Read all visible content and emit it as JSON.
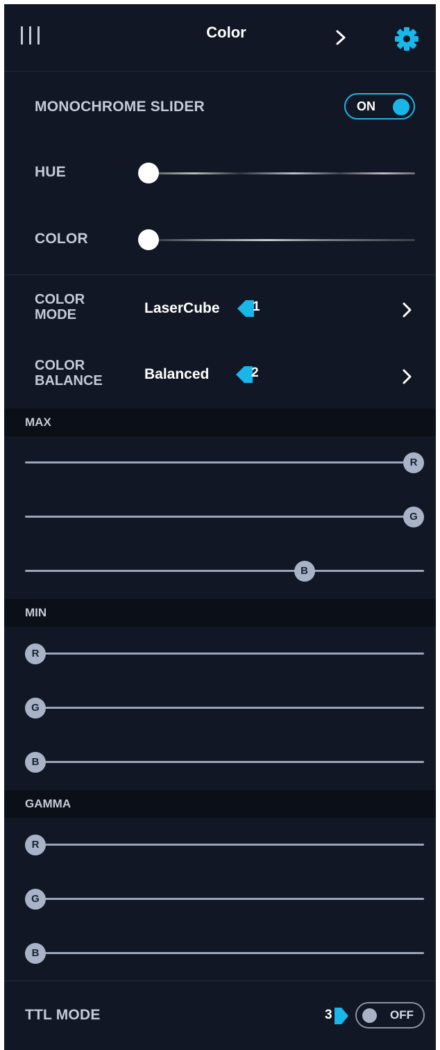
{
  "header": {
    "title": "Color"
  },
  "monochrome": {
    "label": "MONOCHROME SLIDER",
    "toggle_text": "ON",
    "toggle_on": true
  },
  "hue": {
    "label": "HUE",
    "value": 0
  },
  "color": {
    "label": "COLOR",
    "value": 0
  },
  "color_mode": {
    "label_line1": "COLOR",
    "label_line2": "MODE",
    "value": "LaserCube",
    "badge": "1"
  },
  "color_balance": {
    "label_line1": "COLOR",
    "label_line2": "BALANCE",
    "value": "Balanced",
    "badge": "2"
  },
  "max": {
    "title": "MAX",
    "sliders": [
      {
        "channel": "R",
        "value": 1.0
      },
      {
        "channel": "G",
        "value": 1.0
      },
      {
        "channel": "B",
        "value": 0.7
      }
    ]
  },
  "min": {
    "title": "MIN",
    "sliders": [
      {
        "channel": "R",
        "value": 0.0
      },
      {
        "channel": "G",
        "value": 0.0
      },
      {
        "channel": "B",
        "value": 0.0
      }
    ]
  },
  "gamma": {
    "title": "GAMMA",
    "sliders": [
      {
        "channel": "R",
        "value": 0.0
      },
      {
        "channel": "G",
        "value": 0.0
      },
      {
        "channel": "B",
        "value": 0.0
      }
    ]
  },
  "ttl_mode": {
    "label": "TTL MODE",
    "badge": "3",
    "toggle_text": "OFF",
    "toggle_on": false
  },
  "colors": {
    "background": "#111724",
    "accent": "#19b6ea",
    "section_background": "#0b0f18",
    "slider_track": "#9aa5bb",
    "slider_knob": "#a8b3c8"
  },
  "icons": {
    "menu": "menu-bars-icon",
    "forward": "chevron-right-icon",
    "settings": "gear-icon"
  }
}
